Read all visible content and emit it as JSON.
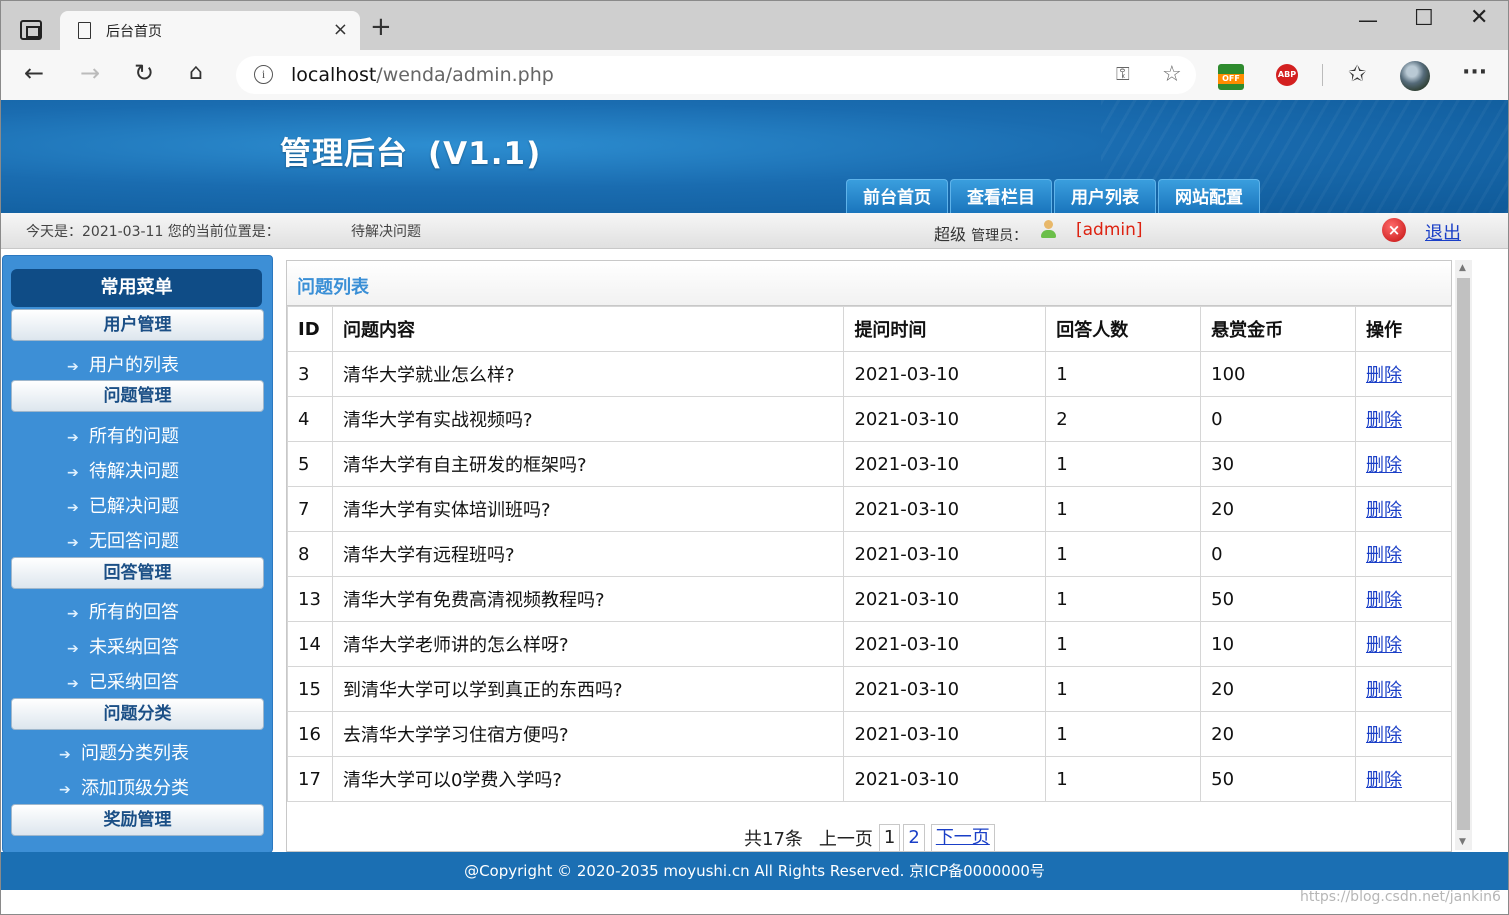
{
  "browser": {
    "tab_title": "后台首页",
    "tab_close": "×",
    "new_tab": "+",
    "url_host": "localhost",
    "url_path": "/wenda/admin.php",
    "ext_off_label": "OFF",
    "ext_abp_label": "ABP",
    "icons": [
      "back-icon",
      "forward-icon",
      "refresh-icon",
      "home-icon",
      "info-icon",
      "key-icon",
      "add-favorite-icon",
      "favorites-icon",
      "more-icon"
    ]
  },
  "header": {
    "title": "管理后台",
    "version": "(V1.1)",
    "nav": [
      "前台首页",
      "查看栏目",
      "用户列表",
      "网站配置"
    ]
  },
  "infobar": {
    "today": "今天是：2021-03-11 您的当前位置是：",
    "current": "待解决问题",
    "admin_prefix": "超级",
    "admin_label": "管理员：",
    "admin_name": "[admin]",
    "logout": "退出"
  },
  "sidebar": {
    "title": "常用菜单",
    "groups": [
      {
        "label": "用户管理",
        "items": [
          "用户的列表"
        ]
      },
      {
        "label": "问题管理",
        "items": [
          "所有的问题",
          "待解决问题",
          "已解决问题",
          "无回答问题"
        ]
      },
      {
        "label": "回答管理",
        "items": [
          "所有的回答",
          "未采纳回答",
          "已采纳回答"
        ]
      },
      {
        "label": "问题分类",
        "items": [
          "问题分类列表",
          "添加顶级分类"
        ]
      },
      {
        "label": "奖励管理",
        "items": []
      }
    ]
  },
  "main": {
    "panel_title": "问题列表",
    "columns": [
      "ID",
      "问题内容",
      "提问时间",
      "回答人数",
      "悬赏金币",
      "操作"
    ],
    "rows": [
      {
        "id": "3",
        "content": "清华大学就业怎么样?",
        "time": "2021-03-10",
        "answers": "1",
        "reward": "100",
        "action": "删除"
      },
      {
        "id": "4",
        "content": "清华大学有实战视频吗?",
        "time": "2021-03-10",
        "answers": "2",
        "reward": "0",
        "action": "删除"
      },
      {
        "id": "5",
        "content": "清华大学有自主研发的框架吗?",
        "time": "2021-03-10",
        "answers": "1",
        "reward": "30",
        "action": "删除"
      },
      {
        "id": "7",
        "content": "清华大学有实体培训班吗?",
        "time": "2021-03-10",
        "answers": "1",
        "reward": "20",
        "action": "删除"
      },
      {
        "id": "8",
        "content": "清华大学有远程班吗?",
        "time": "2021-03-10",
        "answers": "1",
        "reward": "0",
        "action": "删除"
      },
      {
        "id": "13",
        "content": "清华大学有免费高清视频教程吗?",
        "time": "2021-03-10",
        "answers": "1",
        "reward": "50",
        "action": "删除"
      },
      {
        "id": "14",
        "content": "清华大学老师讲的怎么样呀?",
        "time": "2021-03-10",
        "answers": "1",
        "reward": "10",
        "action": "删除"
      },
      {
        "id": "15",
        "content": "到清华大学可以学到真正的东西吗?",
        "time": "2021-03-10",
        "answers": "1",
        "reward": "20",
        "action": "删除"
      },
      {
        "id": "16",
        "content": "去清华大学学习住宿方便吗?",
        "time": "2021-03-10",
        "answers": "1",
        "reward": "20",
        "action": "删除"
      },
      {
        "id": "17",
        "content": "清华大学可以0学费入学吗?",
        "time": "2021-03-10",
        "answers": "1",
        "reward": "50",
        "action": "删除"
      }
    ],
    "pager": {
      "total": "共17条",
      "prev": "上一页",
      "pages": [
        "1",
        "2"
      ],
      "next": "下一页"
    }
  },
  "footer": {
    "copyright": "@Copyright © 2020-2035 moyushi.cn All Rights Reserved. 京ICP备0000000号",
    "watermark": "https://blog.csdn.net/jankin6"
  }
}
